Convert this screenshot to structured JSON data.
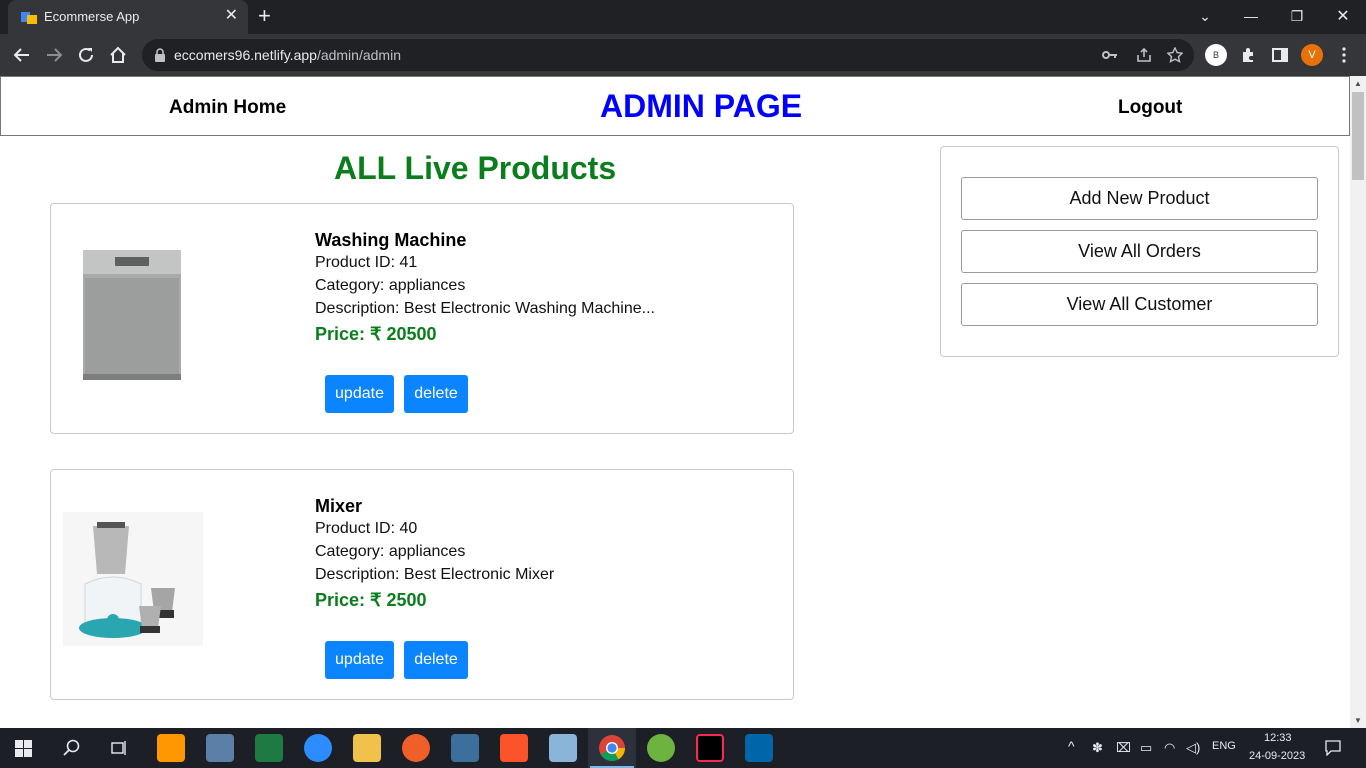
{
  "browser": {
    "tab_title": "Ecommerse App",
    "url_host": "eccomers96.netlify.app",
    "url_path": "/admin/admin",
    "profile_b": "B",
    "profile_v": "V"
  },
  "navbar": {
    "home_label": "Admin Home",
    "title": "ADMIN PAGE",
    "logout_label": "Logout"
  },
  "main": {
    "heading": "ALL Live Products",
    "products": [
      {
        "name": "Washing Machine",
        "product_id": "Product ID: 41",
        "category": "Category: appliances",
        "description": "Description: Best Electronic Washing Machine...",
        "price": "Price: ₹ 20500",
        "update_label": "update",
        "delete_label": "delete"
      },
      {
        "name": "Mixer",
        "product_id": "Product ID: 40",
        "category": "Category: appliances",
        "description": "Description: Best Electronic Mixer",
        "price": "Price: ₹ 2500",
        "update_label": "update",
        "delete_label": "delete"
      }
    ]
  },
  "sidebar": {
    "add_product": "Add New Product",
    "view_orders": "View All Orders",
    "view_customers": "View All Customer"
  },
  "taskbar": {
    "lang": "ENG",
    "time": "12:33",
    "date": "24-09-2023"
  },
  "colors": {
    "title_blue": "#0000ff",
    "heading_green": "#0a7d1c",
    "button_blue": "#0a84ff"
  }
}
